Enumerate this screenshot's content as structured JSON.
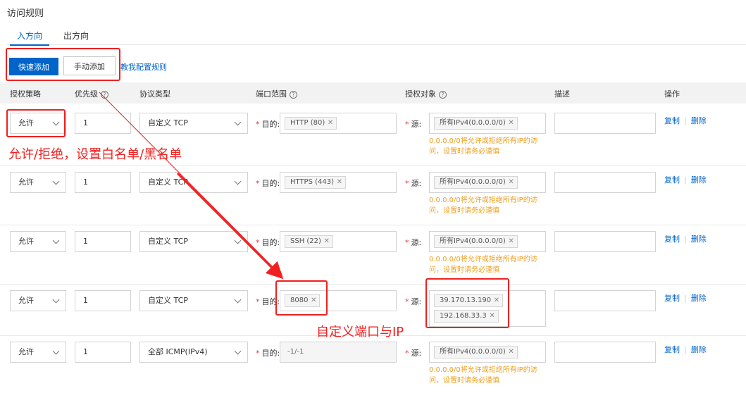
{
  "page_title": "访问规则",
  "tabs": [
    {
      "label": "入方向",
      "active": true
    },
    {
      "label": "出方向",
      "active": false
    }
  ],
  "toolbar": {
    "quick_add": "快速添加",
    "manual_add": "手动添加",
    "help_link": "教我配置规则"
  },
  "columns": {
    "policy": "授权策略",
    "priority": "优先级",
    "protocol": "协议类型",
    "port_range": "端口范围",
    "auth_target": "授权对象",
    "description": "描述",
    "actions": "操作"
  },
  "labels": {
    "dest": "目的:",
    "source": "源:",
    "copy": "复制",
    "delete": "删除",
    "warning_line1": "0.0.0.0/0将允许或拒绝所有IP的访",
    "warning_line2": "问，设置时请务必谨慎"
  },
  "rules": [
    {
      "policy": "允许",
      "priority": "1",
      "protocol": "自定义 TCP",
      "port": "HTTP (80)",
      "sources": [
        "所有IPv4(0.0.0.0/0)"
      ],
      "warning": true
    },
    {
      "policy": "允许",
      "priority": "1",
      "protocol": "自定义 TCP",
      "port": "HTTPS (443)",
      "sources": [
        "所有IPv4(0.0.0.0/0)"
      ],
      "warning": true
    },
    {
      "policy": "允许",
      "priority": "1",
      "protocol": "自定义 TCP",
      "port": "SSH (22)",
      "sources": [
        "所有IPv4(0.0.0.0/0)"
      ],
      "warning": true
    },
    {
      "policy": "允许",
      "priority": "1",
      "protocol": "自定义 TCP",
      "port": "8080",
      "sources": [
        "39.170.13.190",
        "192.168.33.3"
      ],
      "warning": false
    },
    {
      "policy": "允许",
      "priority": "1",
      "protocol": "全部 ICMP(IPv4)",
      "port": "-1/-1",
      "port_disabled": true,
      "sources": [
        "所有IPv4(0.0.0.0/0)"
      ],
      "warning": true
    }
  ],
  "annotations": {
    "allow_deny": "允许/拒绝，设置白名单/黑名单",
    "custom_port_ip": "自定义端口与IP"
  },
  "annotation_color": "#f02020",
  "accent_color": "#0064c8",
  "warning_color": "#f0a020"
}
